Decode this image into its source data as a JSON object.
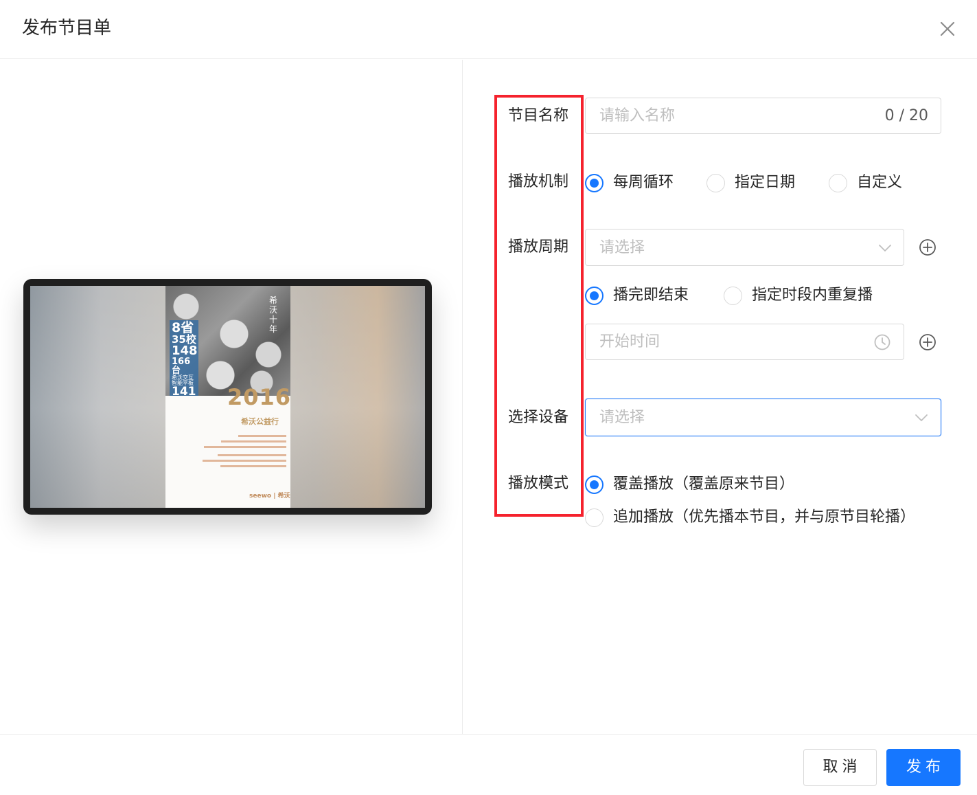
{
  "dialog": {
    "title": "发布节目单"
  },
  "preview": {
    "poster": {
      "panel_lines": [
        "8省",
        "35校",
        "148",
        "166台",
        "希沃交互智能平板",
        "141"
      ],
      "corner_text": "希沃十年",
      "year": "2016",
      "subtitle": "希沃公益行",
      "brand": "seewo | 希沃"
    }
  },
  "form": {
    "name": {
      "label": "节目名称",
      "placeholder": "请输入名称",
      "count": "0 / 20"
    },
    "mechanism": {
      "label": "播放机制",
      "options": [
        {
          "label": "每周循环",
          "checked": true
        },
        {
          "label": "指定日期",
          "checked": false
        },
        {
          "label": "自定义",
          "checked": false
        }
      ]
    },
    "period": {
      "label": "播放周期",
      "placeholder": "请选择",
      "end_options": [
        {
          "label": "播完即结束",
          "checked": true
        },
        {
          "label": "指定时段内重复播",
          "checked": false
        }
      ],
      "start_time_placeholder": "开始时间"
    },
    "device": {
      "label": "选择设备",
      "placeholder": "请选择"
    },
    "mode": {
      "label": "播放模式",
      "options": [
        {
          "label": "覆盖播放（覆盖原来节目）",
          "checked": true
        },
        {
          "label": "追加播放（优先播本节目，并与原节目轮播）",
          "checked": false
        }
      ]
    }
  },
  "footer": {
    "cancel_label": "取消",
    "publish_label": "发布"
  },
  "colors": {
    "primary": "#1677ff",
    "highlight_box": "#f5222d",
    "poster_accent": "#c19a63"
  }
}
